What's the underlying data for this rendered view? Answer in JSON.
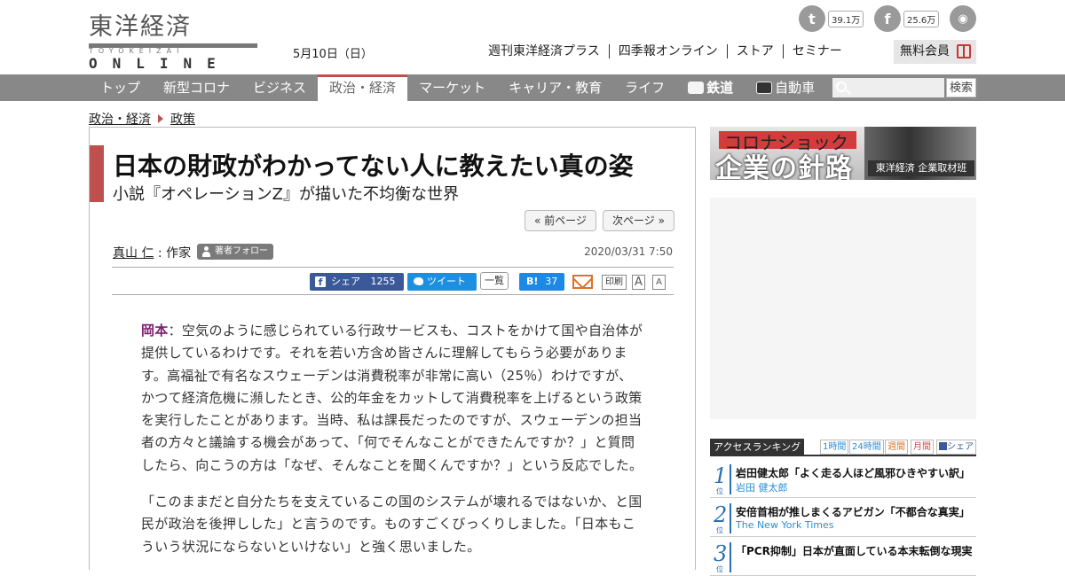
{
  "header": {
    "logo_kanji": "東洋経済",
    "logo_sub": "TOYOKEIZAI",
    "logo_online": "ONLINE",
    "date": "5月10日（日）",
    "top_links": [
      "週刊東洋経済プラス",
      "四季報オンライン",
      "ストア",
      "セミナー"
    ],
    "free_member": "無料会員",
    "twitter_count": "39.1万",
    "facebook_count": "25.6万",
    "icons": [
      "twitter-icon",
      "facebook-icon",
      "rss-icon",
      "gift-icon"
    ]
  },
  "nav": {
    "items": [
      "トップ",
      "新型コロナ",
      "ビジネス",
      "政治・経済",
      "マーケット",
      "キャリア・教育",
      "ライフ",
      "鉄道",
      "自動車"
    ],
    "active_index": 3,
    "search_button": "検索"
  },
  "breadcrumb": [
    "政治・経済",
    "政策"
  ],
  "article": {
    "title": "日本の財政がわかってない人に教えたい真の姿",
    "subtitle": "小説『オペレーションZ』が描いた不均衡な世界",
    "prev_page": "« 前ページ",
    "next_page": "次ページ »",
    "author_name": "真山 仁",
    "author_role": "作家",
    "follow_label": "著者フォロー",
    "pubdate": "2020/03/31 7:50",
    "share_label": "シェア",
    "share_count": "1255",
    "tweet_label": "ツイート",
    "ichiran": "一覧",
    "hatena_label": "B!",
    "hatena_count": "37",
    "print_label": "印刷",
    "font_large": "A",
    "font_small": "A",
    "speaker": "岡本",
    "paragraph1": "：空気のように感じられている行政サービスも、コストをかけて国や自治体が提供しているわけです。それを若い方含め皆さんに理解してもらう必要があります。高福祉で有名なスウェーデンは消費税率が非常に高い（25％）わけですが、かつて経済危機に瀕したとき、公的年金をカットして消費税率を上げるという政策を実行したことがあります。当時、私は課長だったのですが、スウェーデンの担当者の方々と議論する機会があって、「何でそんなことができたんですか？」と質問したら、向こうの方は「なぜ、そんなことを聞くんですか？」という反応でした。",
    "paragraph2": "「このままだと自分たちを支えているこの国のシステムが壊れるではないか、と国民が政治を後押しした」と言うのです。ものすごくびっくりしました。「日本もこういう状況にならないといけない」と強く思いました。"
  },
  "sidebar": {
    "banner_tag": "コロナショック",
    "banner_main": "企業の針路",
    "banner_corp": "東洋経済 企業取材班",
    "ranking_title": "アクセスランキング",
    "ranking_tabs": [
      "1時間",
      "24時間",
      "週間",
      "月間",
      "シェア"
    ],
    "ranking": [
      {
        "num": "1",
        "pos": "位",
        "title": "岩田健太郎「よく走る人ほど風邪ひきやすい訳」",
        "author": "岩田 健太郎"
      },
      {
        "num": "2",
        "pos": "位",
        "title": "安倍首相が推しまくるアビガン「不都合な真実」",
        "author": "The New York Times"
      },
      {
        "num": "3",
        "pos": "位",
        "title": "「PCR抑制」日本が直面している本末転倒な現実",
        "author": ""
      }
    ]
  },
  "colors": {
    "accent_red": "#c0504d",
    "nav_gray": "#888888",
    "facebook": "#3b5998",
    "twitter": "#1d8fe0",
    "speaker": "#7a1e6e",
    "ranking_blue": "#2a6fb7"
  }
}
